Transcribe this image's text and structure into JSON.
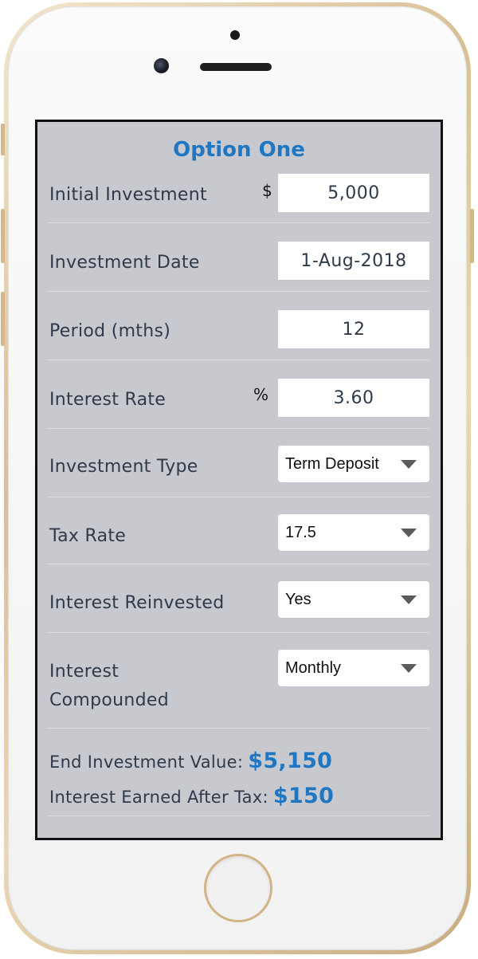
{
  "card": {
    "title": "Option One"
  },
  "fields": {
    "initial_investment": {
      "label": "Initial Investment",
      "prefix": "$",
      "value": "5,000"
    },
    "investment_date": {
      "label": "Investment Date",
      "value": "1-Aug-2018"
    },
    "period": {
      "label": "Period (mths)",
      "value": "12"
    },
    "interest_rate": {
      "label": "Interest Rate",
      "prefix": "%",
      "value": "3.60"
    },
    "investment_type": {
      "label": "Investment Type",
      "selected": "Term Deposit"
    },
    "tax_rate": {
      "label": "Tax Rate",
      "selected": "17.5"
    },
    "interest_reinvested": {
      "label": "Interest Reinvested",
      "selected": "Yes"
    },
    "interest_compounded": {
      "label_line1": "Interest",
      "label_line2": "Compounded",
      "selected": "Monthly"
    }
  },
  "results": {
    "end_value_label": "End Investment Value:",
    "end_value": "$5,150",
    "interest_label": "Interest Earned After Tax:",
    "interest_value": "$150"
  },
  "colors": {
    "accent": "#1f77c4",
    "panel": "#c8c9ce",
    "text": "#2e3a4a",
    "phone_frame": "#d9bf94"
  },
  "icons": {
    "dropdown": "chevron-down-icon"
  }
}
